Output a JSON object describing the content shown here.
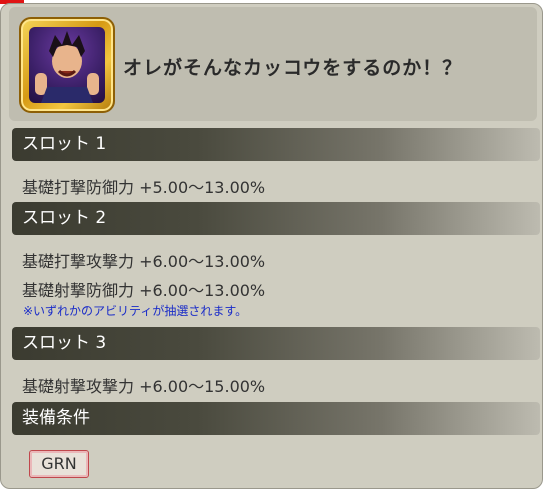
{
  "header": {
    "title": "オレがそんなカッコウをするのか！？",
    "portrait_icon": "character-portrait-icon"
  },
  "slots": [
    {
      "label": "スロット 1",
      "abilities": [
        "基礎打撃防御力 +5.00〜13.00%"
      ]
    },
    {
      "label": "スロット 2",
      "abilities": [
        "基礎打撃攻撃力 +6.00〜13.00%",
        "基礎射撃防御力 +6.00〜13.00%"
      ],
      "note": "※いずれかのアビリティが抽選されます。"
    },
    {
      "label": "スロット 3",
      "abilities": [
        "基礎射撃攻撃力 +6.00〜15.00%"
      ]
    }
  ],
  "equip": {
    "label": "装備条件",
    "classes": [
      "GRN"
    ]
  },
  "colors": {
    "panel_bg": "#cfcdc0",
    "bar_dark": "#3b3b30",
    "note_blue": "#1a2cc8",
    "tag_border": "#c0474c"
  }
}
